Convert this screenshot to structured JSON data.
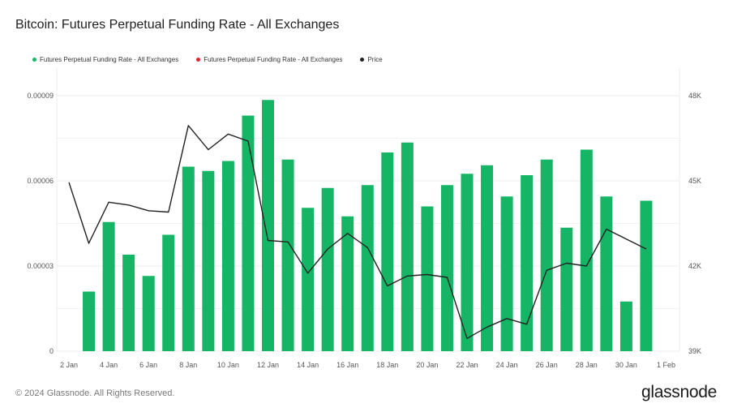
{
  "title": "Bitcoin: Futures Perpetual Funding Rate - All Exchanges",
  "footer": "© 2024 Glassnode. All Rights Reserved.",
  "brand": "glassnode",
  "legend": [
    {
      "label": "Futures Perpetual Funding Rate - All Exchanges",
      "color": "#15b565"
    },
    {
      "label": "Futures Perpetual Funding Rate - All Exchanges",
      "color": "#e0252b"
    },
    {
      "label": "Price",
      "color": "#222222"
    }
  ],
  "chart_data": {
    "type": "bar",
    "title": "Bitcoin: Futures Perpetual Funding Rate - All Exchanges",
    "x_ticks": [
      "2 Jan",
      "4 Jan",
      "6 Jan",
      "8 Jan",
      "10 Jan",
      "12 Jan",
      "14 Jan",
      "16 Jan",
      "18 Jan",
      "20 Jan",
      "22 Jan",
      "24 Jan",
      "26 Jan",
      "28 Jan",
      "30 Jan",
      "1 Feb"
    ],
    "y_left_ticks": [
      "0",
      "0.00003",
      "0.00006",
      "0.00009"
    ],
    "y_right_ticks": [
      "39K",
      "42K",
      "45K",
      "48K"
    ],
    "ylim_left": [
      0,
      0.0001
    ],
    "ylim_right": [
      39000,
      49000
    ],
    "grid": true,
    "legend_position": "top-left",
    "series": [
      {
        "name": "Futures Perpetual Funding Rate - All Exchanges",
        "type": "bar",
        "color": "#15b565",
        "axis": "left",
        "x": [
          "3 Jan",
          "4 Jan",
          "5 Jan",
          "6 Jan",
          "7 Jan",
          "8 Jan",
          "9 Jan",
          "10 Jan",
          "11 Jan",
          "12 Jan",
          "13 Jan",
          "14 Jan",
          "15 Jan",
          "16 Jan",
          "17 Jan",
          "18 Jan",
          "19 Jan",
          "20 Jan",
          "21 Jan",
          "22 Jan",
          "23 Jan",
          "24 Jan",
          "25 Jan",
          "26 Jan",
          "27 Jan",
          "28 Jan",
          "29 Jan",
          "30 Jan",
          "31 Jan"
        ],
        "values": [
          2.1e-05,
          4.55e-05,
          3.4e-05,
          2.65e-05,
          4.1e-05,
          6.5e-05,
          6.35e-05,
          6.7e-05,
          8.3e-05,
          8.85e-05,
          6.75e-05,
          5.05e-05,
          5.75e-05,
          4.75e-05,
          5.85e-05,
          7e-05,
          7.35e-05,
          5.1e-05,
          5.85e-05,
          6.25e-05,
          6.55e-05,
          5.45e-05,
          6.2e-05,
          6.75e-05,
          4.35e-05,
          7.1e-05,
          5.45e-05,
          1.75e-05,
          5.3e-05
        ]
      },
      {
        "name": "Price",
        "type": "line",
        "color": "#222222",
        "axis": "right",
        "x": [
          "2 Jan",
          "3 Jan",
          "4 Jan",
          "5 Jan",
          "6 Jan",
          "7 Jan",
          "8 Jan",
          "9 Jan",
          "10 Jan",
          "11 Jan",
          "12 Jan",
          "13 Jan",
          "14 Jan",
          "15 Jan",
          "16 Jan",
          "17 Jan",
          "18 Jan",
          "19 Jan",
          "20 Jan",
          "21 Jan",
          "22 Jan",
          "23 Jan",
          "24 Jan",
          "25 Jan",
          "26 Jan",
          "27 Jan",
          "28 Jan",
          "29 Jan",
          "30 Jan",
          "31 Jan"
        ],
        "values": [
          44950,
          42800,
          44250,
          44150,
          43950,
          43900,
          46950,
          46100,
          46650,
          46400,
          42900,
          42850,
          41750,
          42600,
          43150,
          42650,
          41300,
          41650,
          41700,
          41600,
          39450,
          39850,
          40150,
          39950,
          41850,
          42100,
          42000,
          43300,
          42950,
          42600
        ]
      }
    ]
  }
}
